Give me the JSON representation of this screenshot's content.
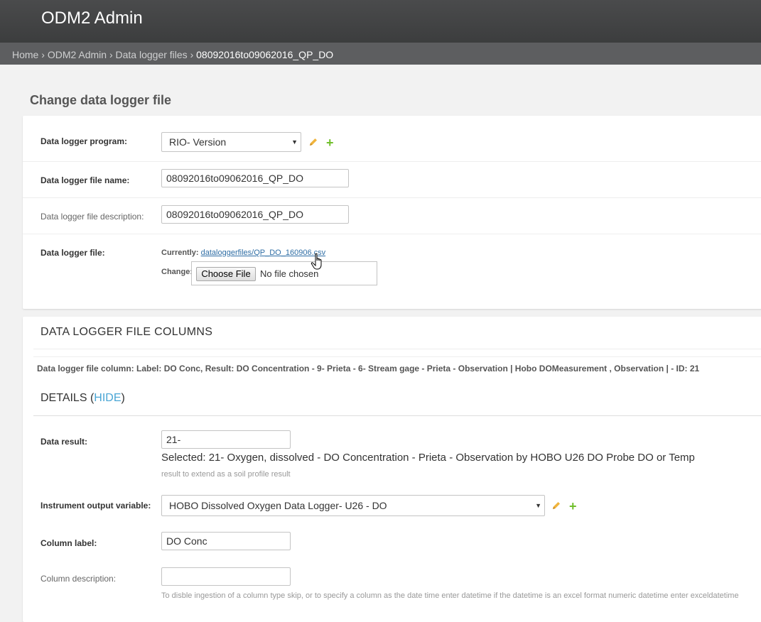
{
  "header": {
    "title": "ODM2 Admin"
  },
  "breadcrumbs": {
    "home": "Home",
    "app": "ODM2 Admin",
    "model": "Data logger files",
    "current": "08092016to09062016_QP_DO",
    "separator": "›"
  },
  "page_title": "Change data logger file",
  "form": {
    "program_label": "Data logger program:",
    "program_value": "RIO- Version",
    "file_name_label": "Data logger file name:",
    "file_name_value": "08092016to09062016_QP_DO",
    "file_desc_label": "Data logger file description:",
    "file_desc_value": "08092016to09062016_QP_DO",
    "file_label": "Data logger file:",
    "currently_label": "Currently:",
    "currently_link": "dataloggerfiles/QP_DO_160906.csv",
    "change_label": "Change:",
    "choose_file": "Choose File",
    "no_file": "No file chosen"
  },
  "columns_section": {
    "title": "DATA LOGGER FILE COLUMNS",
    "column_summary": "Data logger file column: Label: DO Conc, Result: DO Concentration - 9- Prieta - 6- Stream gage - Prieta - Observation | Hobo DOMeasurement , Observation | - ID: 21",
    "details_prefix": "DETAILS (",
    "details_hide": "HIDE",
    "details_suffix": ")",
    "data_result_label": "Data result:",
    "data_result_value": "21-",
    "data_result_selected": "Selected: 21- Oxygen, dissolved - DO Concentration - Prieta - Observation by HOBO U26 DO Probe DO or Temp",
    "data_result_help": "result to extend as a soil profile result",
    "instrument_label": "Instrument output variable:",
    "instrument_value": "HOBO Dissolved Oxygen Data Logger- U26 - DO",
    "column_label_label": "Column label:",
    "column_label_value": "DO Conc",
    "column_desc_label": "Column description:",
    "column_desc_value": "",
    "column_desc_help": "To disble ingestion of a column type skip, or to specify a column as the date time enter datetime if the datetime is an excel format numeric datetime enter exceldatetime"
  },
  "colors": {
    "header": "#3c3d3e",
    "breadcrumb_bar": "#5d5e60",
    "link": "#2f6ea5",
    "add_green": "#70bf2b",
    "edit_yellow": "#f0b43c",
    "hide_link": "#4aa6d5"
  }
}
